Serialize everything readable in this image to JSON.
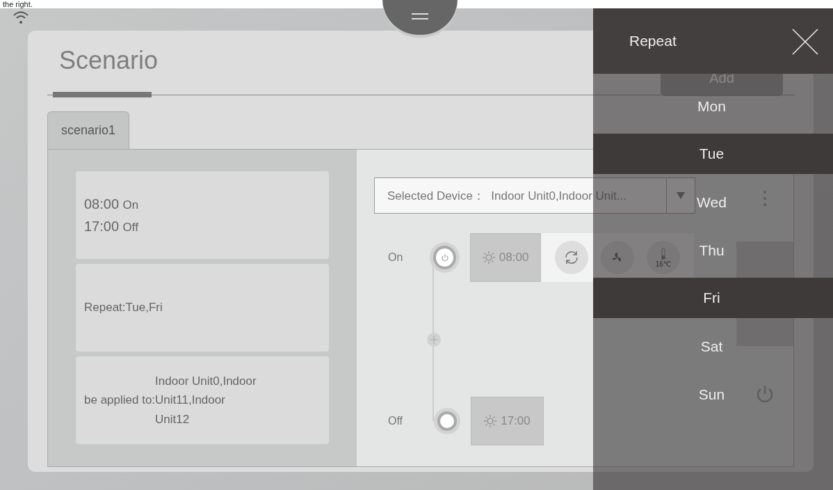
{
  "caption": "the right.",
  "title": "Scenario",
  "tabs": [
    {
      "label": "scenario1",
      "selected": true
    }
  ],
  "summary": {
    "times": [
      {
        "time": "08:00",
        "action": "On"
      },
      {
        "time": "17:00",
        "action": "Off"
      }
    ],
    "repeat": "Repeat:Tue,Fri",
    "applied_label": "be applied to:",
    "applied_value": "Indoor Unit0,Indoor Unit11,Indoor Unit12"
  },
  "device_select": {
    "label": "Selected Device：",
    "value": "Indoor Unit0,Indoor Unit..."
  },
  "events": [
    {
      "kind": "on",
      "label": "On",
      "time": "08:00",
      "temperature": "16℃"
    },
    {
      "kind": "off",
      "label": "Off",
      "time": "17:00"
    }
  ],
  "add_button": "Add",
  "repeat_panel": {
    "title": "Repeat",
    "days": [
      {
        "label": "Mon",
        "selected": false
      },
      {
        "label": "Tue",
        "selected": true
      },
      {
        "label": "Wed",
        "selected": false
      },
      {
        "label": "Thu",
        "selected": false
      },
      {
        "label": "Fri",
        "selected": true
      },
      {
        "label": "Sat",
        "selected": false
      },
      {
        "label": "Sun",
        "selected": false
      }
    ]
  }
}
